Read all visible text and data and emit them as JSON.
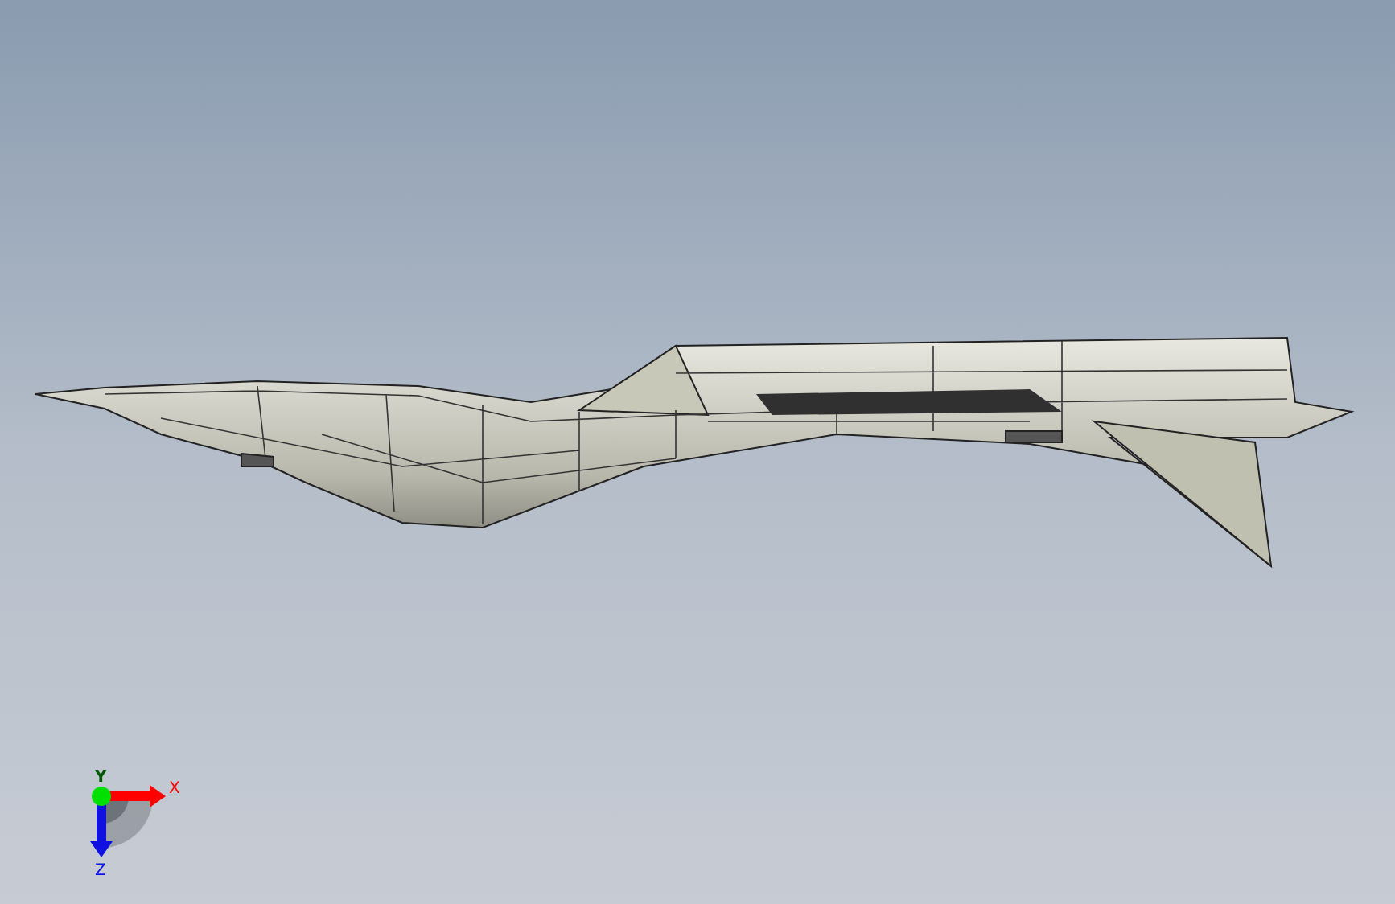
{
  "viewport": {
    "axes": [
      {
        "label": "X",
        "kind": "right",
        "color": "#ff0000"
      },
      {
        "label": "Z",
        "kind": "down",
        "color": "#1010e0"
      },
      {
        "label": "Y",
        "kind": "toward",
        "color": "#00e000"
      }
    ]
  }
}
